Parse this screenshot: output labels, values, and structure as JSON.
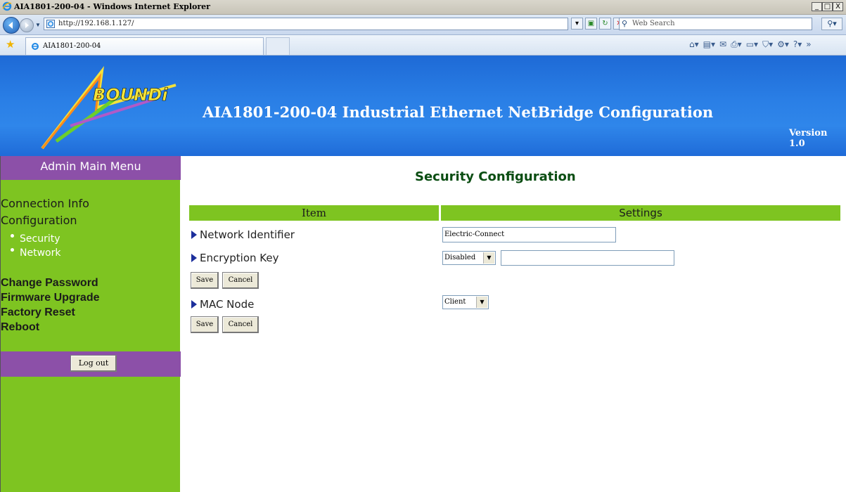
{
  "window": {
    "title": "AIA1801-200-04 - Windows Internet Explorer",
    "controls": [
      "_",
      "□",
      "X"
    ]
  },
  "browser": {
    "url": "http://192.168.1.127/",
    "search_placeholder": "Web Search",
    "tab_label": "AIA1801-200-04"
  },
  "banner": {
    "logo_text": "BOUNDi",
    "heading": "AIA1801-200-04 Industrial Ethernet NetBridge Configuration",
    "version": "Version 1.0"
  },
  "sidebar": {
    "menu_title": "Admin Main Menu",
    "links": [
      "Connection Info",
      "Configuration"
    ],
    "sub_links": [
      "Security",
      "Network"
    ],
    "bold_links": [
      "Change Password",
      "Firmware Upgrade",
      "Factory Reset",
      "Reboot"
    ],
    "logout_label": "Log out"
  },
  "main": {
    "title": "Security Configuration",
    "col_item": "Item",
    "col_settings": "Settings",
    "network_identifier_label": "Network Identifier",
    "network_identifier_value": "Electric-Connect",
    "encryption_key_label": "Encryption Key",
    "encryption_mode": "Disabled",
    "encryption_key_value": "",
    "mac_node_label": "MAC Node",
    "mac_node_value": "Client",
    "save_label": "Save",
    "cancel_label": "Cancel"
  },
  "colors": {
    "banner_blue": "#2a7fe6",
    "menu_green": "#7ec421",
    "menu_purple": "#8c50a8",
    "title_green": "#0a4d12"
  }
}
